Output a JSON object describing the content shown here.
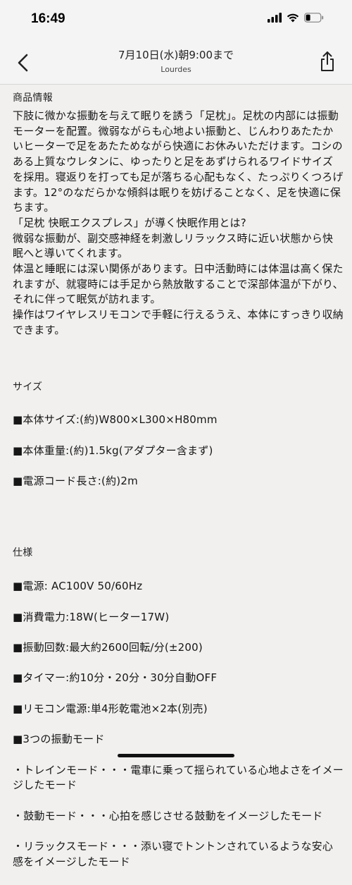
{
  "status_bar": {
    "time": "16:49"
  },
  "nav": {
    "title": "7月10日(水)朝9:00まで",
    "subtitle": "Lourdes",
    "back_icon": "chevron-left-icon",
    "share_icon": "share-icon"
  },
  "product_info": {
    "heading": "商品情報",
    "body": "下肢に微かな振動を与えて眠りを誘う「足枕」。足枕の内部には振動モーターを配置。微弱ながらも心地よい振動と、じんわりあたたかいヒーターで足をあたためながら快適にお休みいただけます。コシのある上質なウレタンに、ゆったりと足をあずけられるワイドサイズを採用。寝返りを打っても足が落ちる心配もなく、たっぷりくつろげます。12°のなだらかな傾斜は眠りを妨げることなく、足を快適に保ちます。\n「足枕 快眠エクスプレス」が導く快眠作用とは?\n微弱な振動が、副交感神経を刺激しリラックス時に近い状態から快眠へと導いてくれます。\n体温と睡眠には深い関係があります。日中活動時には体温は高く保たれますが、就寝時には手足から熱放散することで深部体温が下がり、それに伴って眠気が訪れます。\n操作はワイヤレスリモコンで手軽に行えるうえ、本体にすっきり収納できます。"
  },
  "size": {
    "heading": "サイズ",
    "lines": [
      "■本体サイズ:(約)W800×L300×H80mm",
      "■本体重量:(約)1.5kg(アダプター含まず)",
      "■電源コード長さ:(約)2m"
    ]
  },
  "spec": {
    "heading": "仕様",
    "lines": [
      "■電源: AC100V 50/60Hz",
      "■消費電力:18W(ヒーター17W)",
      "■振動回数:最大約2600回転/分(±200)",
      "■タイマー:約10分・20分・30分自動OFF",
      "■リモコン電源:単4形乾電池×2本(別売)",
      "■3つの振動モード",
      "・トレインモード・・・電車に乗って揺られている心地よさをイメージしたモード",
      "・鼓動モード・・・心拍を感じさせる鼓動をイメージしたモード",
      "・リラックスモード・・・添い寝でトントンされているような安心感をイメージしたモード"
    ]
  }
}
